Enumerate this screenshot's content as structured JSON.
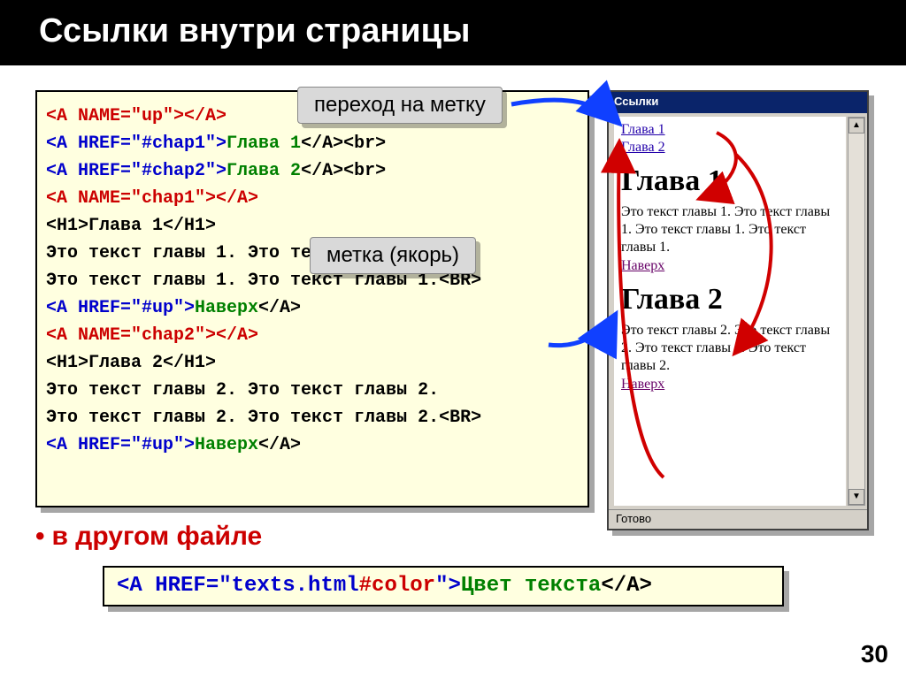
{
  "slide": {
    "title": "Ссылки внутри страницы",
    "page_number": "30"
  },
  "callouts": {
    "jump_to_anchor": "переход на метку",
    "anchor_label": "метка (якорь)"
  },
  "code_lines": {
    "l1_a": "<A NAME=\"up\"></A>",
    "l2_a": "<A HREF=\"#chap1\">",
    "l2_b": "Глава 1",
    "l2_c": "</A><br>",
    "l3_a": "<A HREF=\"#chap2\">",
    "l3_b": "Глава 2",
    "l3_c": "</A><br>",
    "l4_a": "<A NAME=\"chap1\"></A>",
    "l5_a": "<H1>",
    "l5_b": "Глава 1",
    "l5_c": "</H1>",
    "l6": "Это текст главы 1. Это текст главы 1.",
    "l7_a": "Это текст главы 1. Это текст главы 1.",
    "l7_b": "<BR>",
    "l8_a": "<A HREF=\"#up\">",
    "l8_b": "Наверх",
    "l8_c": "</A>",
    "l9_a": "<A NAME=\"chap2\"></A>",
    "l10_a": "<H1>",
    "l10_b": "Глава 2",
    "l10_c": "</H1>",
    "l11": "Это текст главы 2. Это текст главы 2.",
    "l12_a": "Это текст главы 2. Это текст главы 2.",
    "l12_b": "<BR>",
    "l13_a": "<A HREF=\"#up\">",
    "l13_b": "Наверх",
    "l13_c": "</A>"
  },
  "bullet": {
    "text": "в другом файле"
  },
  "code2": {
    "a": "<A HREF=\"texts.html",
    "b": "#color",
    "c": "\">",
    "d": "Цвет текста",
    "e": "</A>"
  },
  "browser": {
    "title": "Ссылки",
    "link1": "Глава 1",
    "link2": "Глава 2",
    "h1a": "Глава 1",
    "text1": "Это текст главы 1. Это текст главы 1. Это текст главы 1. Это текст главы 1.",
    "up1": "Наверх",
    "h1b": "Глава 2",
    "text2": "Это текст главы 2. Это текст главы 2. Это текст главы 2. Это текст главы 2.",
    "up2": "Наверх",
    "status": "Готово"
  }
}
